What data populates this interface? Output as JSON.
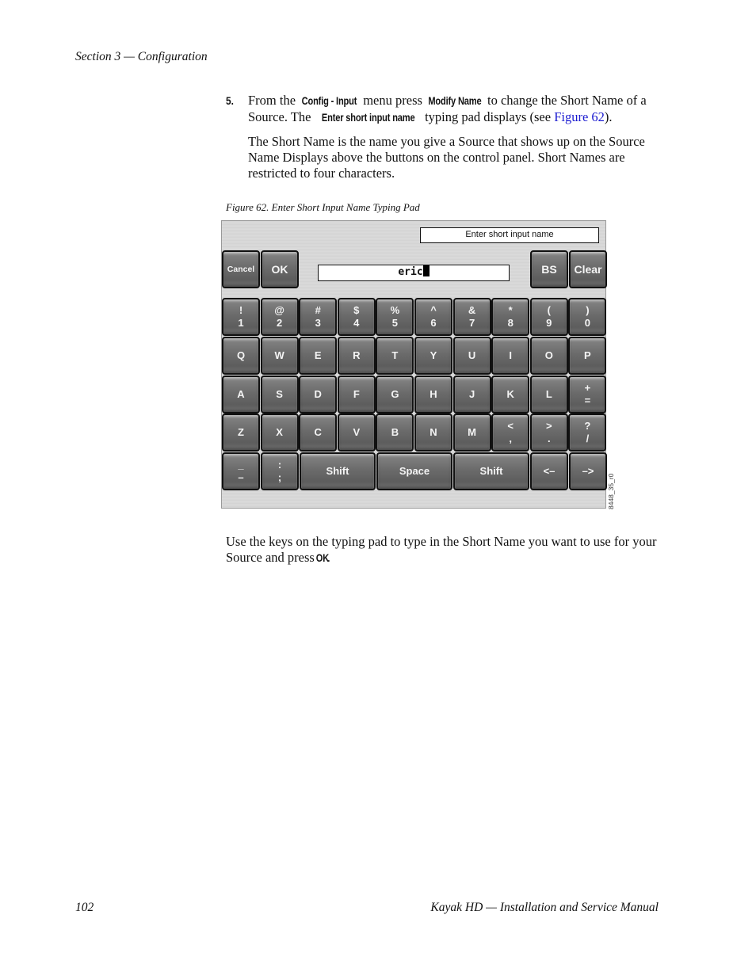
{
  "header": {
    "section": "Section 3 — Configuration"
  },
  "step": {
    "number": "5.",
    "line1_a": "From the ",
    "line1_ui1": "Config - Input",
    "line1_b": " menu press ",
    "line1_ui2": "Modify Name",
    "line1_c": " to change the Short Name of a Source. The ",
    "line1_ui3": "Enter short input name",
    "line1_d": " typing pad displays (see ",
    "line1_link": "Figure 62",
    "line1_e": ").",
    "para2": "The Short Name is the name you give a Source that shows up on the Source Name Displays above the buttons on the control panel. Short Names are restricted to four characters."
  },
  "figure": {
    "caption": "Figure 62.  Enter Short Input Name Typing Pad",
    "id_label": "8448_35_r0",
    "pad": {
      "title": "Enter short input name",
      "entry_value": "eric",
      "top_buttons": {
        "cancel": "Cancel",
        "ok": "OK",
        "bs": "BS",
        "clear": "Clear"
      },
      "rows": [
        [
          [
            "!",
            "1"
          ],
          [
            "@",
            "2"
          ],
          [
            "#",
            "3"
          ],
          [
            "$",
            "4"
          ],
          [
            "%",
            "5"
          ],
          [
            "^",
            "6"
          ],
          [
            "&",
            "7"
          ],
          [
            "*",
            "8"
          ],
          [
            "(",
            "9"
          ],
          [
            ")",
            "0"
          ]
        ],
        [
          [
            "Q"
          ],
          [
            "W"
          ],
          [
            "E"
          ],
          [
            "R"
          ],
          [
            "T"
          ],
          [
            "Y"
          ],
          [
            "U"
          ],
          [
            "I"
          ],
          [
            "O"
          ],
          [
            "P"
          ]
        ],
        [
          [
            "A"
          ],
          [
            "S"
          ],
          [
            "D"
          ],
          [
            "F"
          ],
          [
            "G"
          ],
          [
            "H"
          ],
          [
            "J"
          ],
          [
            "K"
          ],
          [
            "L"
          ],
          [
            "+",
            "="
          ]
        ],
        [
          [
            "Z"
          ],
          [
            "X"
          ],
          [
            "C"
          ],
          [
            "V"
          ],
          [
            "B"
          ],
          [
            "N"
          ],
          [
            "M"
          ],
          [
            "<",
            ","
          ],
          [
            ">",
            "."
          ],
          [
            "?",
            "/"
          ]
        ]
      ],
      "bottom_row": {
        "underscore": [
          "_",
          "–"
        ],
        "colon": [
          ":",
          ";"
        ],
        "shift_left": "Shift",
        "space": "Space",
        "shift_right": "Shift",
        "left_arrow": "<–",
        "right_arrow": "–>"
      }
    }
  },
  "closing": {
    "text": "Use the keys on the typing pad to type in the Short Name you want to use for your Source and press ",
    "ui": "OK",
    "end": "."
  },
  "footer": {
    "page_number": "102",
    "manual_title": "Kayak HD  —  Installation and Service Manual"
  }
}
